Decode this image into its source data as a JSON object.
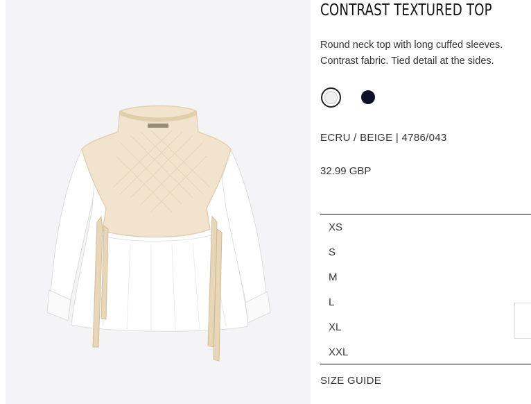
{
  "product": {
    "title": "CONTRAST TEXTURED TOP",
    "description_line1": "Round neck top with long cuffed sleeves.",
    "description_line2": "Contrast fabric. Tied detail at the sides.",
    "colour_ref": "ECRU / BEIGE | 4786/043",
    "price": "32.99 GBP",
    "image_alt": "Contrast textured top in ecru with beige knit vest"
  },
  "swatches": [
    {
      "name": "ecru",
      "color": "#efefef",
      "selected": true
    },
    {
      "name": "navy",
      "color": "#0c1128",
      "selected": false
    }
  ],
  "sizes": [
    "XS",
    "S",
    "M",
    "L",
    "XL",
    "XXL"
  ],
  "size_guide_label": "SIZE GUIDE"
}
